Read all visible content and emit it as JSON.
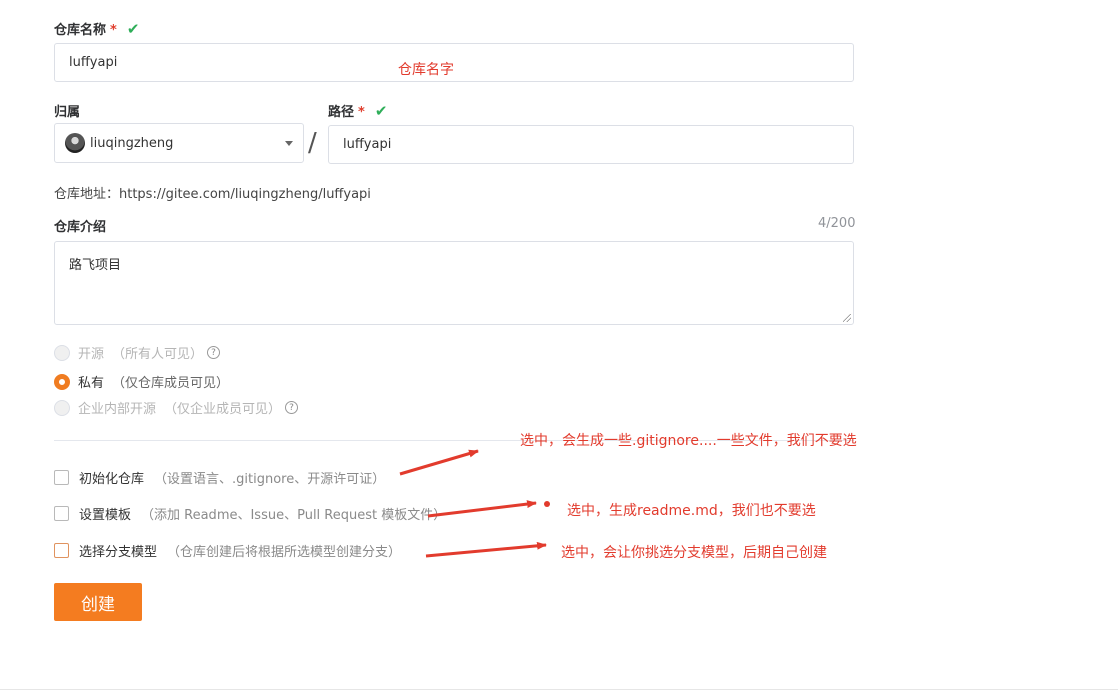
{
  "form": {
    "repo_name_label": "仓库名称",
    "required_mark": "*",
    "check_mark": "✔",
    "repo_name_value": "luffyapi",
    "owner_label": "归属",
    "owner_value": "liuqingzheng",
    "separator": "/",
    "path_label": "路径",
    "path_value": "luffyapi",
    "repo_address": "仓库地址：https://gitee.com/liuqingzheng/luffyapi",
    "intro_label": "仓库介绍",
    "intro_counter": "4/200",
    "intro_value": "路飞项目"
  },
  "visibility": [
    {
      "label": "开源",
      "desc": "（所有人可见）",
      "selected": false,
      "disabled": true
    },
    {
      "label": "私有",
      "desc": "（仅仓库成员可见）",
      "selected": true,
      "disabled": false
    },
    {
      "label": "企业内部开源",
      "desc": "（仅企业成员可见）",
      "selected": false,
      "disabled": true
    }
  ],
  "help_glyph": "?",
  "options": [
    {
      "label": "初始化仓库",
      "desc": "（设置语言、.gitignore、开源许可证）"
    },
    {
      "label": "设置模板",
      "desc": "（添加 Readme、Issue、Pull Request 模板文件）"
    },
    {
      "label": "选择分支模型",
      "desc": "（仓库创建后将根据所选模型创建分支）"
    }
  ],
  "create_button": "创建",
  "annotations": {
    "repo_name_note": "仓库名字",
    "init_note": "选中，会生成一些.gitignore....一些文件，我们不要选",
    "template_note": "选中，生成readme.md，我们也不要选",
    "branch_note": "选中，会让你挑选分支模型，后期自己创建",
    "accent_color": "#e23b2d"
  },
  "colors": {
    "primary": "#f47c20",
    "success": "#2fae59"
  }
}
